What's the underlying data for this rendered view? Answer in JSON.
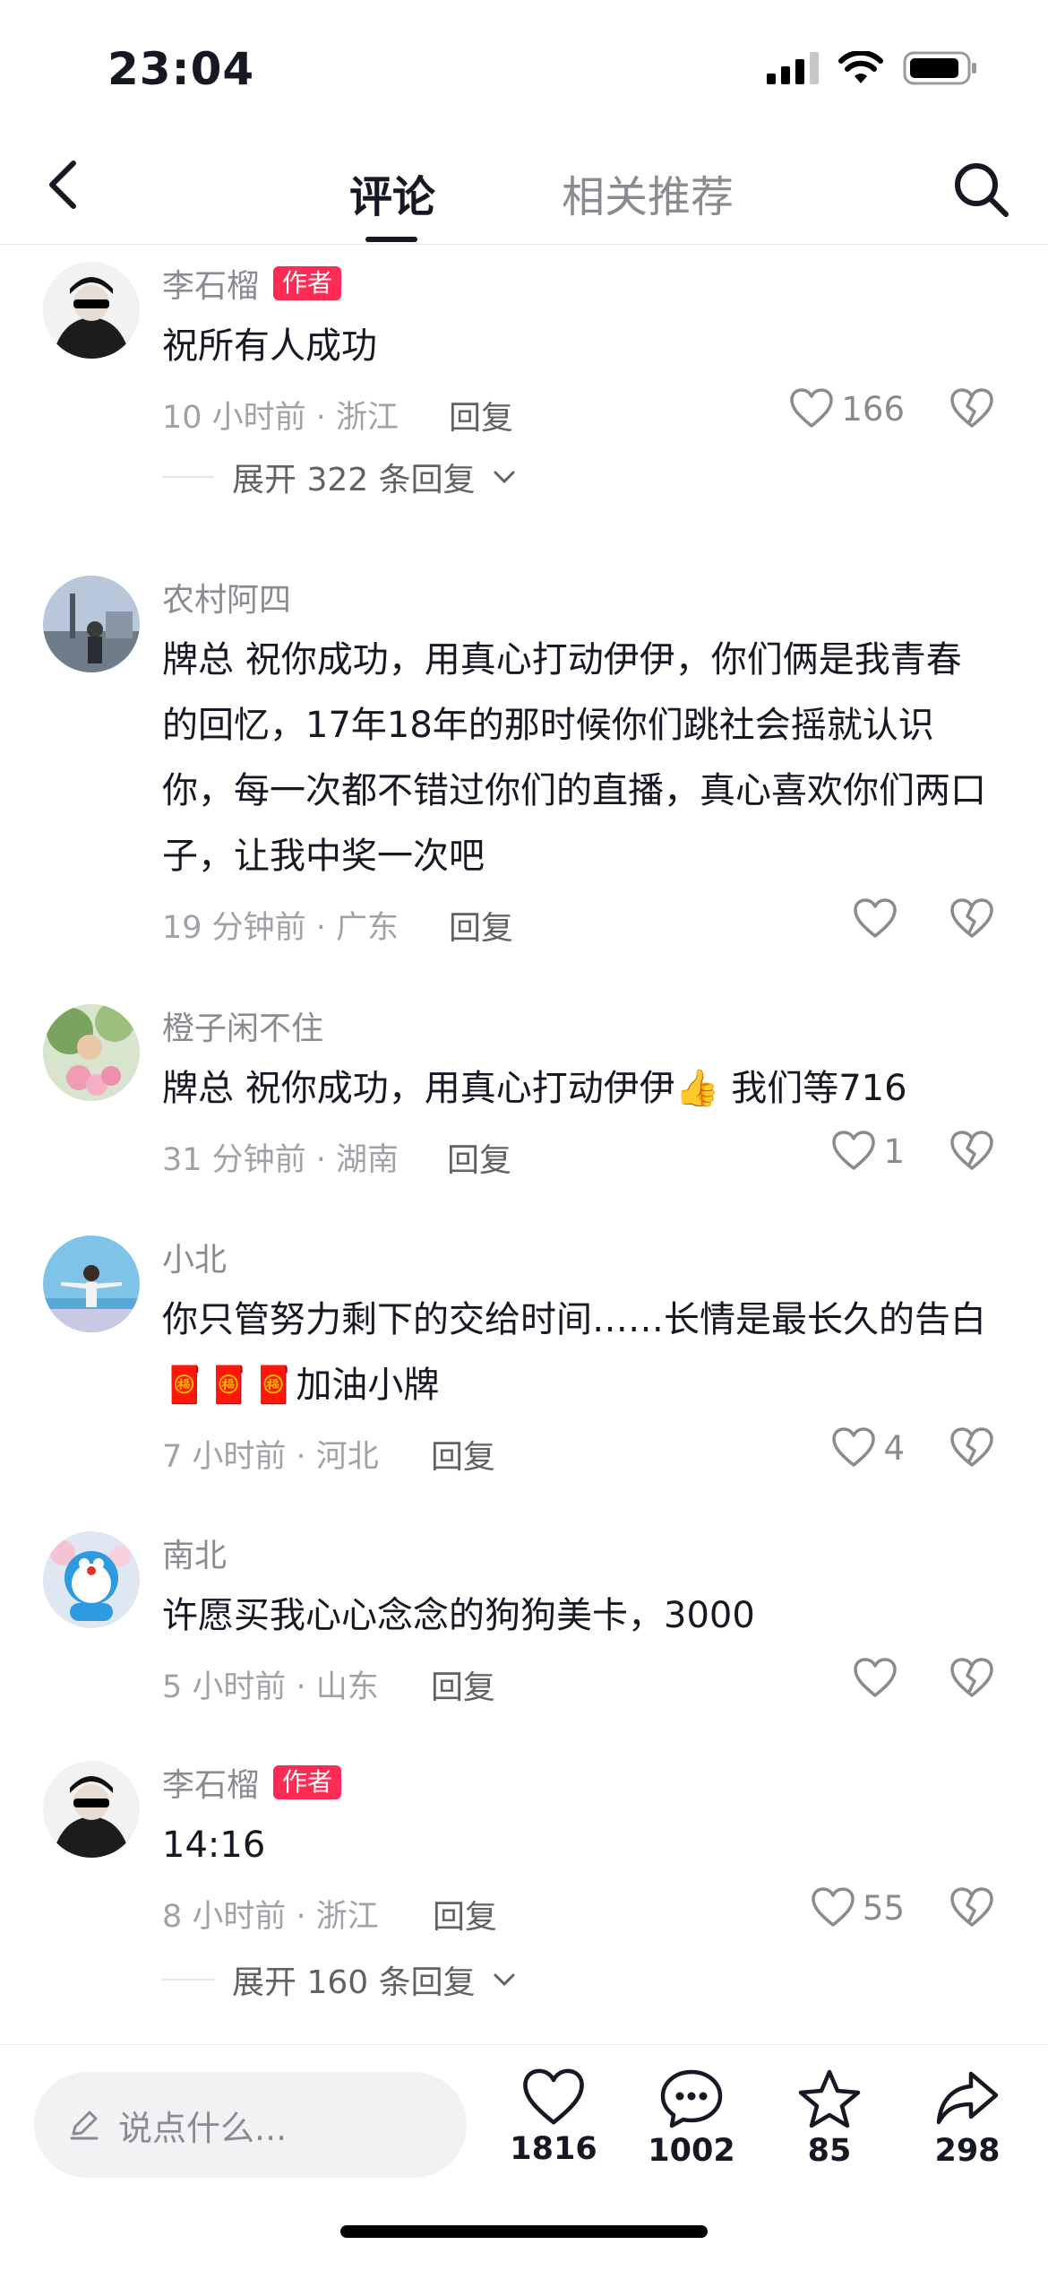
{
  "status_bar": {
    "time": "23:04"
  },
  "nav": {
    "tab_comments": "评论",
    "tab_related": "相关推荐"
  },
  "comments": [
    {
      "username": "李石榴",
      "badge": "作者",
      "text": "祝所有人成功",
      "meta": "10 小时前 · 浙江",
      "reply_label": "回复",
      "likes": "166",
      "expand": "展开 322 条回复"
    },
    {
      "username": "农村阿四",
      "text": "牌总  祝你成功，用真心打动伊伊，你们俩是我青春的回忆，17年18年的那时候你们跳社会摇就认识你，每一次都不错过你们的直播，真心喜欢你们两口子，让我中奖一次吧",
      "meta": "19 分钟前 · 广东",
      "reply_label": "回复",
      "likes": ""
    },
    {
      "username": "橙子闲不住",
      "text": "牌总  祝你成功，用真心打动伊伊👍 我们等716",
      "meta": "31 分钟前 · 湖南",
      "reply_label": "回复",
      "likes": "1"
    },
    {
      "username": "小北",
      "text": "你只管努力剩下的交给时间……长情是最长久的告白🧧🧧🧧加油小牌",
      "meta": "7 小时前 · 河北",
      "reply_label": "回复",
      "likes": "4"
    },
    {
      "username": "南北",
      "text": "许愿买我心心念念的狗狗美卡，3000",
      "meta": "5 小时前 · 山东",
      "reply_label": "回复",
      "likes": ""
    },
    {
      "username": "李石榴",
      "badge": "作者",
      "text": "14:16",
      "meta": "8 小时前 · 浙江",
      "reply_label": "回复",
      "likes": "55",
      "expand": "展开 160 条回复"
    }
  ],
  "bottom_bar": {
    "input_placeholder": "说点什么...",
    "likes": "1816",
    "comments": "1002",
    "favorites": "85",
    "shares": "298"
  },
  "colors": {
    "accent": "#fe2c55",
    "text": "#161823",
    "muted": "#8a8b91"
  }
}
